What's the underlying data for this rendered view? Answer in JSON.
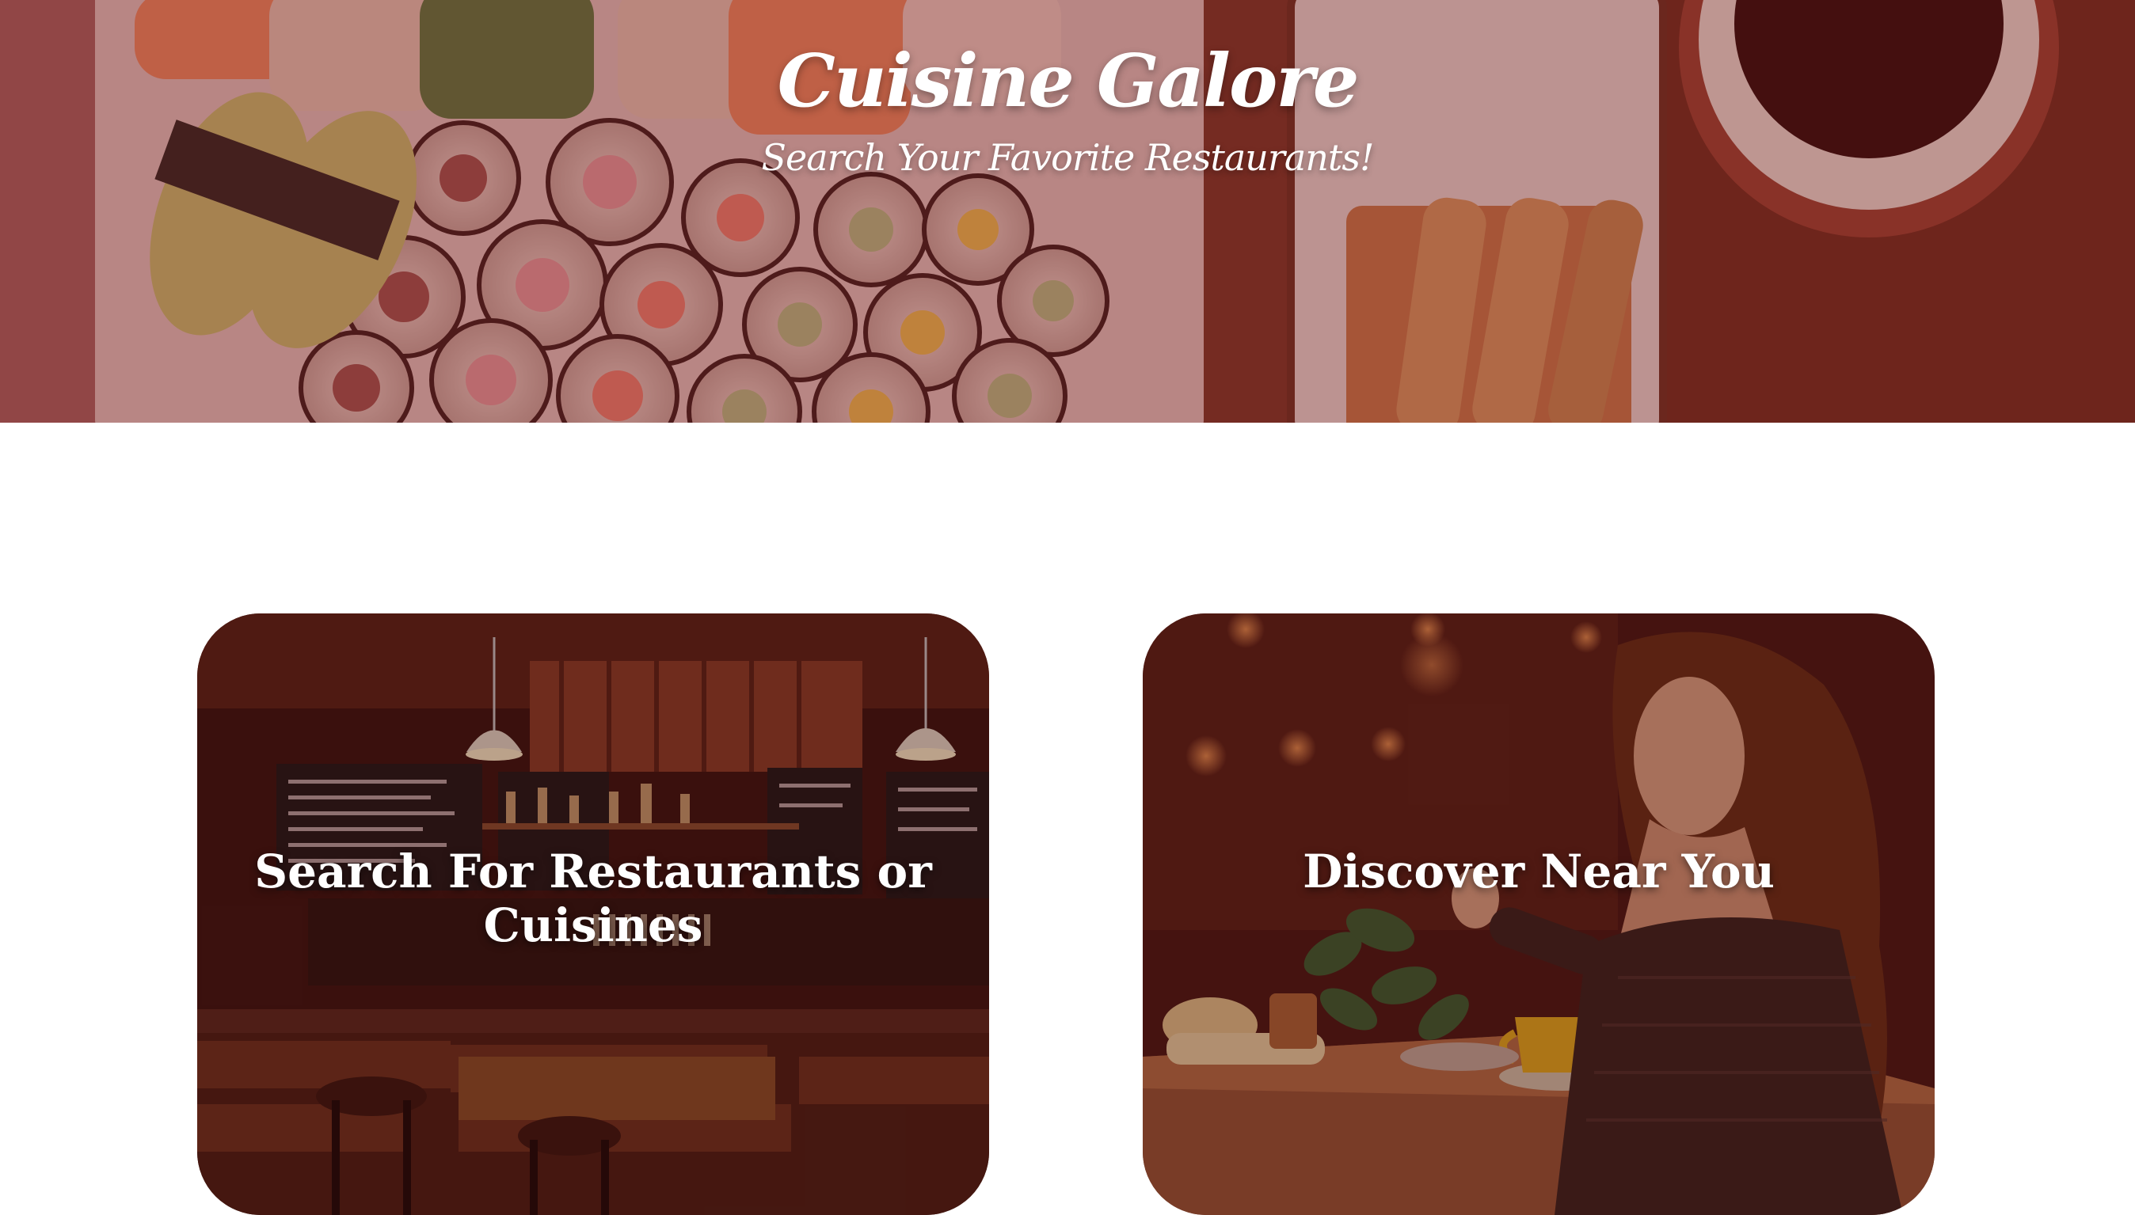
{
  "hero": {
    "title": "Cuisine Galore",
    "subtitle": "Search Your Favorite Restaurants!",
    "image": "sushi-platter-photo"
  },
  "cards": [
    {
      "label": "Search For Restaurants or Cuisines",
      "image": "restaurant-bar-interior-photo"
    },
    {
      "label": "Discover Near You",
      "image": "woman-dining-cafe-photo"
    }
  ],
  "colors": {
    "overlay": "#6e1e1e",
    "card_tint": "#3c0a0a",
    "text": "#ffffff"
  }
}
